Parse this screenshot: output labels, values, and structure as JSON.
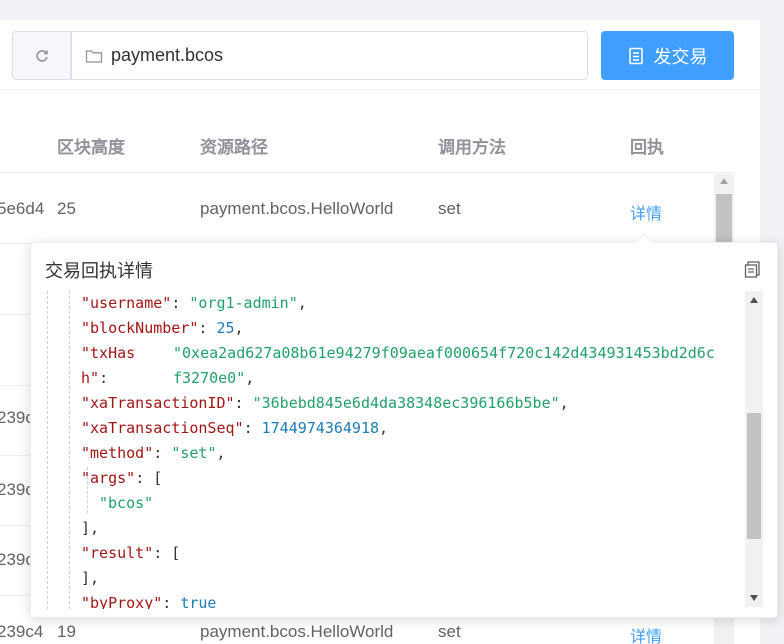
{
  "toolbar": {
    "path_value": "payment.bcos",
    "send_label": "发交易"
  },
  "table": {
    "headers": [
      "区块高度",
      "资源路径",
      "调用方法",
      "回执"
    ],
    "rows": [
      {
        "id_frag": "5e6d4",
        "height": "25",
        "path": "payment.bcos.HelloWorld",
        "method": "set",
        "receipt": "详情"
      },
      {
        "id_frag": "",
        "height": "",
        "path": "",
        "method": "",
        "receipt": ""
      },
      {
        "id_frag": "",
        "height": "",
        "path": "",
        "method": "",
        "receipt": ""
      },
      {
        "id_frag": "239c",
        "height": "",
        "path": "",
        "method": "",
        "receipt": ""
      },
      {
        "id_frag": "239c",
        "height": "",
        "path": "",
        "method": "",
        "receipt": ""
      },
      {
        "id_frag": "239c",
        "height": "",
        "path": "",
        "method": "",
        "receipt": ""
      },
      {
        "id_frag": "239c4",
        "height": "19",
        "path": "payment.bcos.HelloWorld",
        "method": "set",
        "receipt": "详情"
      }
    ]
  },
  "popover": {
    "title": "交易回执详情",
    "json": {
      "username_key": "\"username\"",
      "username_val": "\"org1-admin\"",
      "blockNumber_key": "\"blockNumber\"",
      "blockNumber_val": "25",
      "txHash_key_a": "\"txHas",
      "txHash_key_b": "h\"",
      "txHash_val_a": "\"0xea2ad627a08b61e94279f09aeaf000654f720c142d434931453bd2d6c",
      "txHash_val_b": "f3270e0\"",
      "xaTxID_key": "\"xaTransactionID\"",
      "xaTxID_val": "\"36bebd845e6d4da38348ec396166b5be\"",
      "xaTxSeq_key": "\"xaTransactionSeq\"",
      "xaTxSeq_val": "1744974364918",
      "method_key": "\"method\"",
      "method_val": "\"set\"",
      "args_key": "\"args\"",
      "args_item": "\"bcos\"",
      "result_key": "\"result\"",
      "byProxy_key": "\"byProxy\"",
      "byProxy_val": "true"
    }
  },
  "colors": {
    "primary": "#409eff",
    "json_key": "#a31515",
    "json_string": "#22a06b",
    "json_number": "#1c7bb5"
  }
}
